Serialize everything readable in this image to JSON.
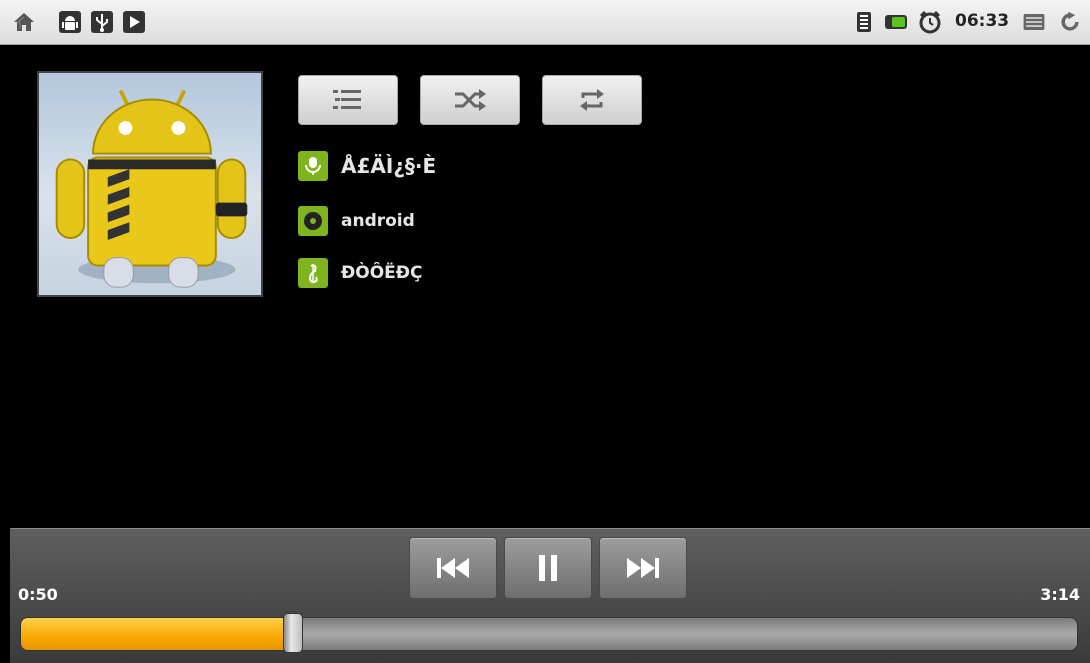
{
  "status_bar": {
    "left_icons": [
      "home-icon",
      "android-debug-icon",
      "usb-icon",
      "play-icon"
    ],
    "right_icons": [
      "wifi-signal-icon",
      "battery-icon",
      "alarm-icon",
      "menu-icon",
      "sync-icon"
    ],
    "time": "06:33"
  },
  "toolbar": {
    "buttons": [
      "playlist-icon",
      "shuffle-icon",
      "repeat-icon"
    ]
  },
  "track": {
    "artist": "Å£ÄÌ¿§·È",
    "album": "android",
    "title": "ÐÒÔËÐÇ"
  },
  "transport": {
    "elapsed": "0:50",
    "total": "3:14",
    "progress": 0.258
  },
  "colors": {
    "accent": "#7fb41e",
    "progress": "#f9a800"
  }
}
